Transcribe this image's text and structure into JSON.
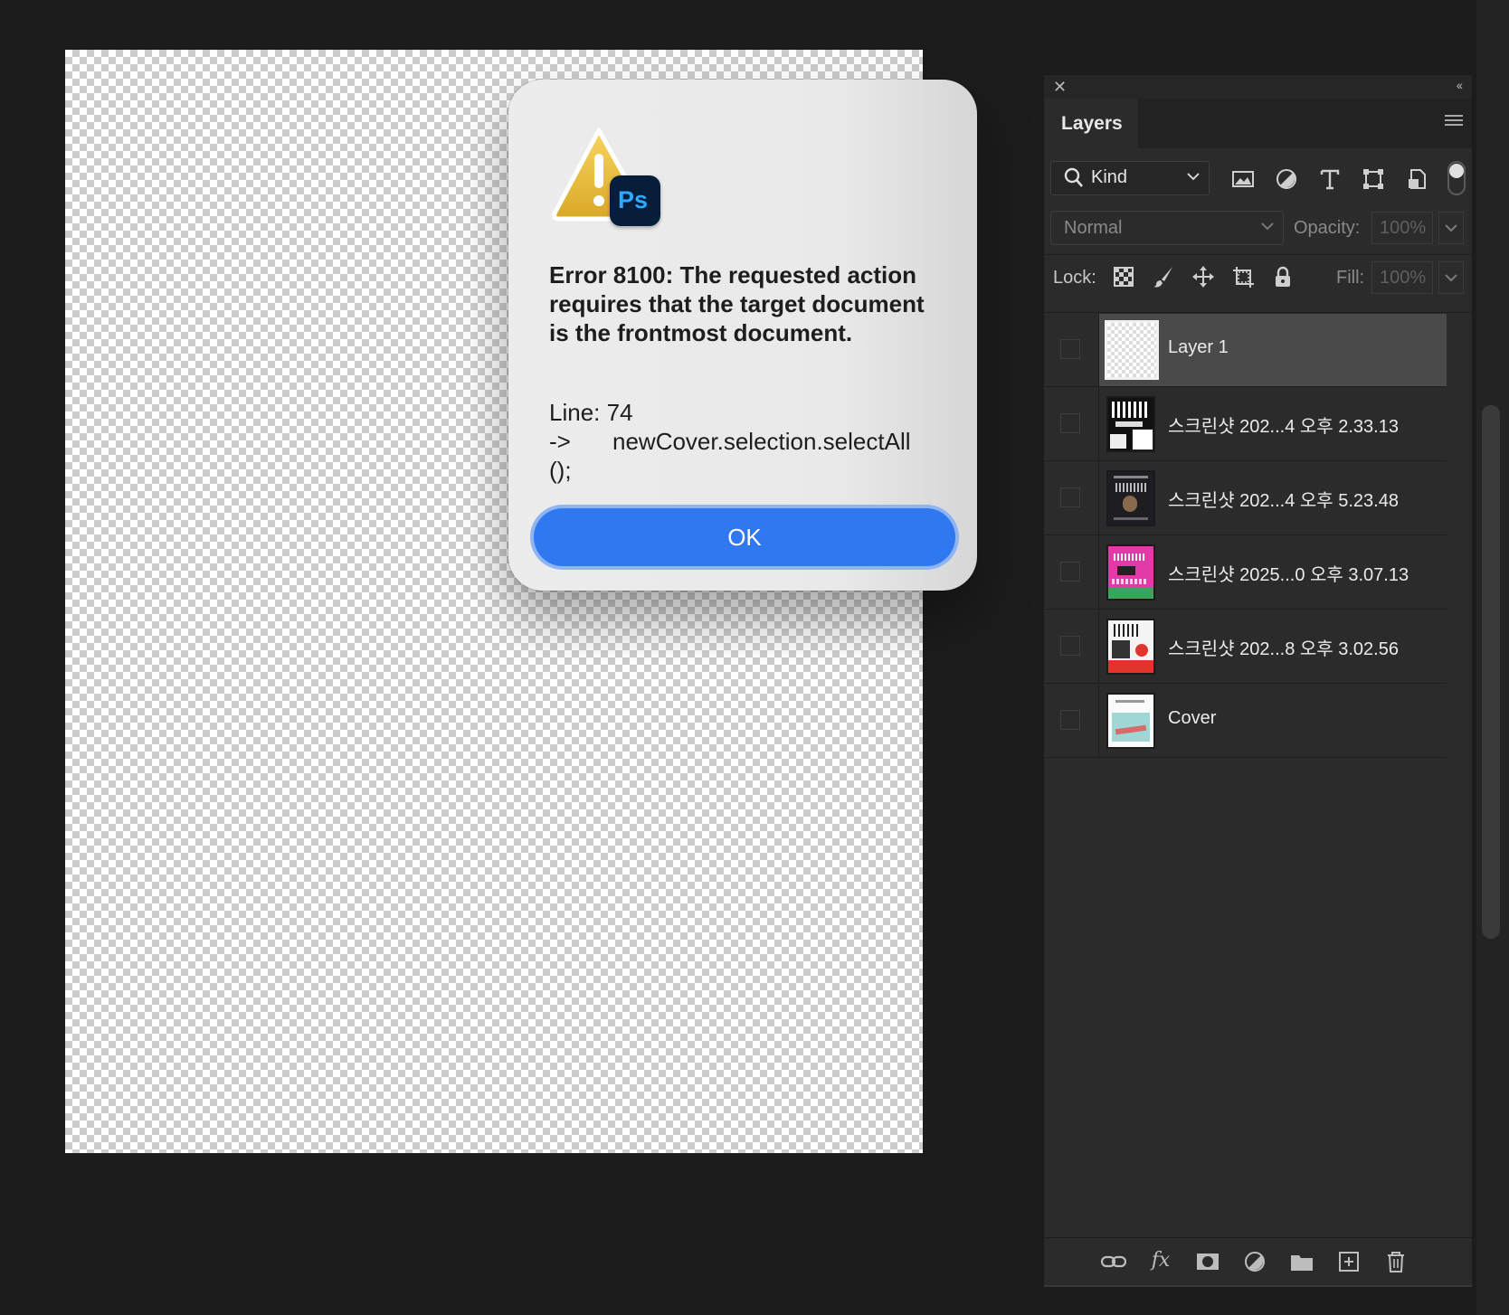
{
  "dialog": {
    "title": "Error 8100: The requested action requires that the target document is the frontmost document.",
    "line_label": "Line: 74",
    "arrow": "->",
    "code": "newCover.selection.selectAll",
    "code_tail": "();",
    "ok_label": "OK",
    "app_badge": "Ps"
  },
  "layers_panel": {
    "tab_label": "Layers",
    "filter_kind": "Kind",
    "blend_mode": "Normal",
    "opacity_label": "Opacity:",
    "opacity_value": "100%",
    "lock_label": "Lock:",
    "fill_label": "Fill:",
    "fill_value": "100%",
    "layers": [
      {
        "name": "Layer 1",
        "selected": true
      },
      {
        "name": "스크린샷 202...4 오후 2.33.13",
        "selected": false
      },
      {
        "name": "스크린샷 202...4 오후 5.23.48",
        "selected": false
      },
      {
        "name": "스크린샷 2025...0 오후 3.07.13",
        "selected": false
      },
      {
        "name": "스크린샷 202...8 오후 3.02.56",
        "selected": false
      },
      {
        "name": "Cover",
        "selected": false
      }
    ]
  },
  "colors": {
    "accent": "#2f78f0",
    "panel_bg": "#2b2b2b",
    "workspace_bg": "#1c1c1c"
  }
}
